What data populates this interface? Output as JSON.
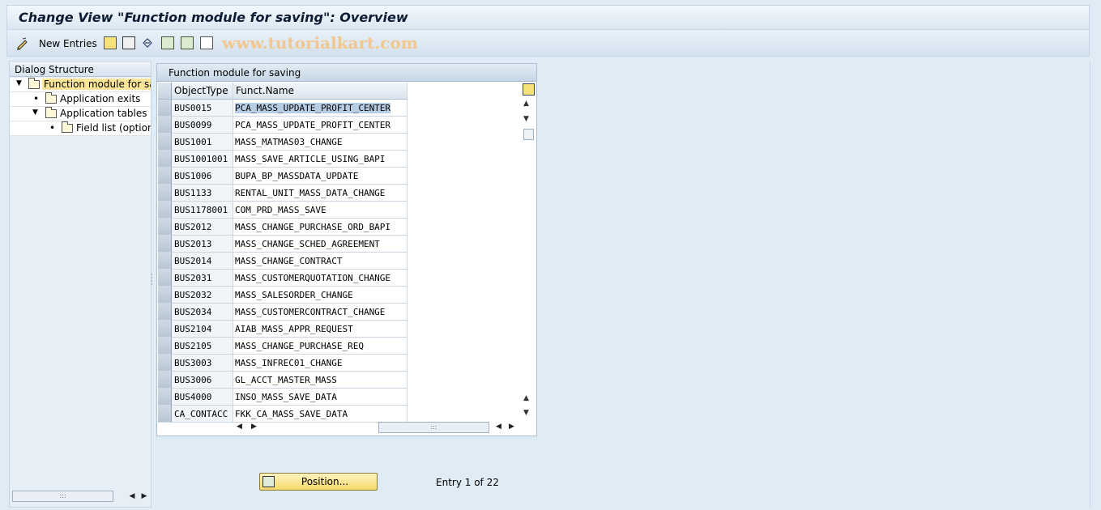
{
  "title": "Change View \"Function module for saving\": Overview",
  "toolbar": {
    "new_entries_label": "New Entries",
    "watermark": "www.tutorialkart.com"
  },
  "dialog_structure": {
    "header": "Dialog Structure",
    "items": [
      {
        "label": "Function module for savi",
        "level": 0,
        "expanded": true,
        "selected": true
      },
      {
        "label": "Application exits",
        "level": 1,
        "expanded": false,
        "selected": false
      },
      {
        "label": "Application tables",
        "level": 1,
        "expanded": true,
        "selected": false
      },
      {
        "label": "Field list (optiona",
        "level": 2,
        "expanded": false,
        "selected": false
      }
    ]
  },
  "table": {
    "title": "Function module for saving",
    "columns": [
      "ObjectType",
      "Funct.Name"
    ],
    "rows": [
      {
        "object_type": "BUS0015",
        "funct_name": "PCA_MASS_UPDATE_PROFIT_CENTER"
      },
      {
        "object_type": "BUS0099",
        "funct_name": "PCA_MASS_UPDATE_PROFIT_CENTER"
      },
      {
        "object_type": "BUS1001",
        "funct_name": "MASS_MATMAS03_CHANGE"
      },
      {
        "object_type": "BUS1001001",
        "funct_name": "MASS_SAVE_ARTICLE_USING_BAPI"
      },
      {
        "object_type": "BUS1006",
        "funct_name": "BUPA_BP_MASSDATA_UPDATE"
      },
      {
        "object_type": "BUS1133",
        "funct_name": "RENTAL_UNIT_MASS_DATA_CHANGE"
      },
      {
        "object_type": "BUS1178001",
        "funct_name": "COM_PRD_MASS_SAVE"
      },
      {
        "object_type": "BUS2012",
        "funct_name": "MASS_CHANGE_PURCHASE_ORD_BAPI"
      },
      {
        "object_type": "BUS2013",
        "funct_name": "MASS_CHANGE_SCHED_AGREEMENT"
      },
      {
        "object_type": "BUS2014",
        "funct_name": "MASS_CHANGE_CONTRACT"
      },
      {
        "object_type": "BUS2031",
        "funct_name": "MASS_CUSTOMERQUOTATION_CHANGE"
      },
      {
        "object_type": "BUS2032",
        "funct_name": "MASS_SALESORDER_CHANGE"
      },
      {
        "object_type": "BUS2034",
        "funct_name": "MASS_CUSTOMERCONTRACT_CHANGE"
      },
      {
        "object_type": "BUS2104",
        "funct_name": "AIAB_MASS_APPR_REQUEST"
      },
      {
        "object_type": "BUS2105",
        "funct_name": "MASS_CHANGE_PURCHASE_REQ"
      },
      {
        "object_type": "BUS3003",
        "funct_name": "MASS_INFREC01_CHANGE"
      },
      {
        "object_type": "BUS3006",
        "funct_name": "GL_ACCT_MASTER_MASS"
      },
      {
        "object_type": "BUS4000",
        "funct_name": "INSO_MASS_SAVE_DATA"
      },
      {
        "object_type": "CA_CONTACC",
        "funct_name": "FKK_CA_MASS_SAVE_DATA"
      }
    ]
  },
  "footer": {
    "position_button_label": "Position...",
    "entry_text": "Entry 1 of 22"
  }
}
